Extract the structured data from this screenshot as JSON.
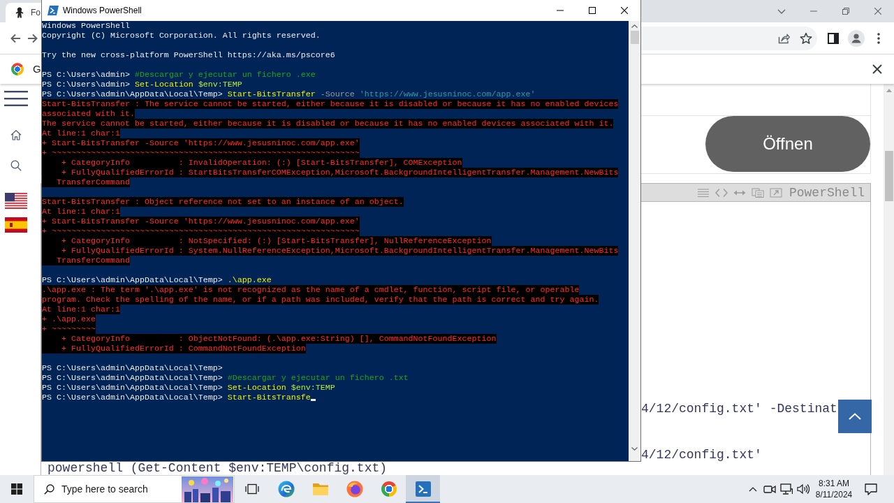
{
  "browser": {
    "tab": {
      "title": "Fo"
    },
    "infobar": {
      "text": "G"
    },
    "page": {
      "open_button": {
        "label": "Öffnen"
      },
      "code_block": {
        "language": "PowerShell",
        "lines": [
          {
            "kind": "tail",
            "text": "4/12/config.txt' -Destinat"
          },
          {
            "kind": "tail",
            "text": "4/12/config.txt'"
          },
          {
            "kind": "whole",
            "text": "powershell (Get-Content $env:TEMP\\config.txt)"
          }
        ]
      }
    }
  },
  "powershell_window": {
    "title": "Windows PowerShell",
    "console": {
      "cursor_visible": true,
      "blocks": [
        {
          "lines": [
            {
              "segments": [
                {
                  "kind": "output",
                  "text": "Windows PowerShell"
                }
              ]
            },
            {
              "segments": [
                {
                  "kind": "output",
                  "text": "Copyright (C) Microsoft Corporation. All rights reserved."
                }
              ]
            }
          ]
        },
        {
          "lines": [
            {
              "segments": [
                {
                  "kind": "output",
                  "text": "Try the new cross-platform PowerShell https://aka.ms/pscore6"
                }
              ]
            }
          ]
        },
        {
          "lines": [
            {
              "segments": [
                {
                  "kind": "prompt",
                  "text": "PS C:\\Users\\admin>"
                },
                {
                  "kind": "comment",
                  "text": "#Descargar y ejecutar un fichero .exe"
                }
              ]
            },
            {
              "segments": [
                {
                  "kind": "prompt",
                  "text": "PS C:\\Users\\admin>"
                },
                {
                  "kind": "command",
                  "text": "Set-Location"
                },
                {
                  "kind": "variable",
                  "text": "$env:TEMP"
                }
              ]
            },
            {
              "segments": [
                {
                  "kind": "prompt",
                  "text": "PS C:\\Users\\admin\\AppData\\Local\\Temp>"
                },
                {
                  "kind": "command",
                  "text": "Start-BitsTransfer"
                },
                {
                  "kind": "parameter",
                  "text": "-Source"
                },
                {
                  "kind": "string",
                  "text": "'https://www.jesusninoc.com/app.exe'"
                }
              ]
            },
            {
              "segments": [
                {
                  "kind": "error",
                  "text": "Start-BitsTransfer : The service cannot be started, either because it is disabled or because it has no enabled devices"
                }
              ]
            },
            {
              "segments": [
                {
                  "kind": "error",
                  "text": "associated with it."
                }
              ]
            },
            {
              "segments": [
                {
                  "kind": "error",
                  "text": "The service cannot be started, either because it is disabled or because it has no enabled devices associated with it."
                }
              ]
            },
            {
              "segments": [
                {
                  "kind": "error",
                  "text": "At line:1 char:1"
                }
              ]
            },
            {
              "segments": [
                {
                  "kind": "error",
                  "text": "+ Start-BitsTransfer -Source 'https://www.jesusninoc.com/app.exe'"
                }
              ]
            },
            {
              "segments": [
                {
                  "kind": "error",
                  "text": "+ ~~~~~~~~~~~~~~~~~~~~~~~~~~~~~~~~~~~~~~~~~~~~~~~~~~~~~~~~~~~~~~~"
                }
              ]
            },
            {
              "segments": [
                {
                  "kind": "error",
                  "text": "    + CategoryInfo          : InvalidOperation: (:) [Start-BitsTransfer], COMException"
                }
              ]
            },
            {
              "segments": [
                {
                  "kind": "error",
                  "text": "    + FullyQualifiedErrorId : StartBitsTransferCOMException,Microsoft.BackgroundIntelligentTransfer.Management.NewBits"
                }
              ]
            },
            {
              "segments": [
                {
                  "kind": "error",
                  "text": "   TransferCommand"
                }
              ]
            }
          ]
        },
        {
          "lines": [
            {
              "segments": [
                {
                  "kind": "error",
                  "text": "Start-BitsTransfer : Object reference not set to an instance of an object."
                }
              ]
            },
            {
              "segments": [
                {
                  "kind": "error",
                  "text": "At line:1 char:1"
                }
              ]
            },
            {
              "segments": [
                {
                  "kind": "error",
                  "text": "+ Start-BitsTransfer -Source 'https://www.jesusninoc.com/app.exe'"
                }
              ]
            },
            {
              "segments": [
                {
                  "kind": "error",
                  "text": "+ ~~~~~~~~~~~~~~~~~~~~~~~~~~~~~~~~~~~~~~~~~~~~~~~~~~~~~~~~~~~~~~~"
                }
              ]
            },
            {
              "segments": [
                {
                  "kind": "error",
                  "text": "    + CategoryInfo          : NotSpecified: (:) [Start-BitsTransfer], NullReferenceException"
                }
              ]
            },
            {
              "segments": [
                {
                  "kind": "error",
                  "text": "    + FullyQualifiedErrorId : System.NullReferenceException,Microsoft.BackgroundIntelligentTransfer.Management.NewBits"
                }
              ]
            },
            {
              "segments": [
                {
                  "kind": "error",
                  "text": "   TransferCommand"
                }
              ]
            }
          ]
        },
        {
          "lines": [
            {
              "segments": [
                {
                  "kind": "prompt",
                  "text": "PS C:\\Users\\admin\\AppData\\Local\\Temp>"
                },
                {
                  "kind": "command",
                  "text": ".\\app.exe"
                }
              ]
            },
            {
              "segments": [
                {
                  "kind": "error",
                  "text": ".\\app.exe : The term '.\\app.exe' is not recognized as the name of a cmdlet, function, script file, or operable"
                }
              ]
            },
            {
              "segments": [
                {
                  "kind": "error",
                  "text": "program. Check the spelling of the name, or if a path was included, verify that the path is correct and try again."
                }
              ]
            },
            {
              "segments": [
                {
                  "kind": "error",
                  "text": "At line:1 char:1"
                }
              ]
            },
            {
              "segments": [
                {
                  "kind": "error",
                  "text": "+ .\\app.exe"
                }
              ]
            },
            {
              "segments": [
                {
                  "kind": "error",
                  "text": "+ ~~~~~~~~~"
                }
              ]
            },
            {
              "segments": [
                {
                  "kind": "error",
                  "text": "    + CategoryInfo          : ObjectNotFound: (.\\app.exe:String) [], CommandNotFoundException"
                }
              ]
            },
            {
              "segments": [
                {
                  "kind": "error",
                  "text": "    + FullyQualifiedErrorId : CommandNotFoundException"
                }
              ]
            }
          ]
        },
        {
          "lines": [
            {
              "segments": [
                {
                  "kind": "prompt",
                  "text": "PS C:\\Users\\admin\\AppData\\Local\\Temp>"
                }
              ]
            },
            {
              "segments": [
                {
                  "kind": "prompt",
                  "text": "PS C:\\Users\\admin\\AppData\\Local\\Temp>"
                },
                {
                  "kind": "comment",
                  "text": "#Descargar y ejecutar un fichero .txt"
                }
              ]
            },
            {
              "segments": [
                {
                  "kind": "prompt",
                  "text": "PS C:\\Users\\admin\\AppData\\Local\\Temp>"
                },
                {
                  "kind": "command",
                  "text": "Set-Location"
                },
                {
                  "kind": "variable",
                  "text": "$env:TEMP"
                }
              ]
            },
            {
              "segments": [
                {
                  "kind": "prompt",
                  "text": "PS C:\\Users\\admin\\AppData\\Local\\Temp>"
                },
                {
                  "kind": "command",
                  "text": "Start-BitsTransfe"
                }
              ]
            }
          ]
        }
      ]
    }
  },
  "taskbar": {
    "search": {
      "placeholder": "Type here to search"
    },
    "apps": [
      {
        "kind": "task_view",
        "selected": false
      },
      {
        "kind": "edge",
        "selected": false
      },
      {
        "kind": "file_explorer",
        "selected": false
      },
      {
        "kind": "firefox",
        "selected": false
      },
      {
        "kind": "chrome",
        "selected": false
      },
      {
        "kind": "powershell",
        "selected": true
      }
    ],
    "clock": {
      "time": "8:31 AM",
      "date": "8/11/2024"
    }
  }
}
